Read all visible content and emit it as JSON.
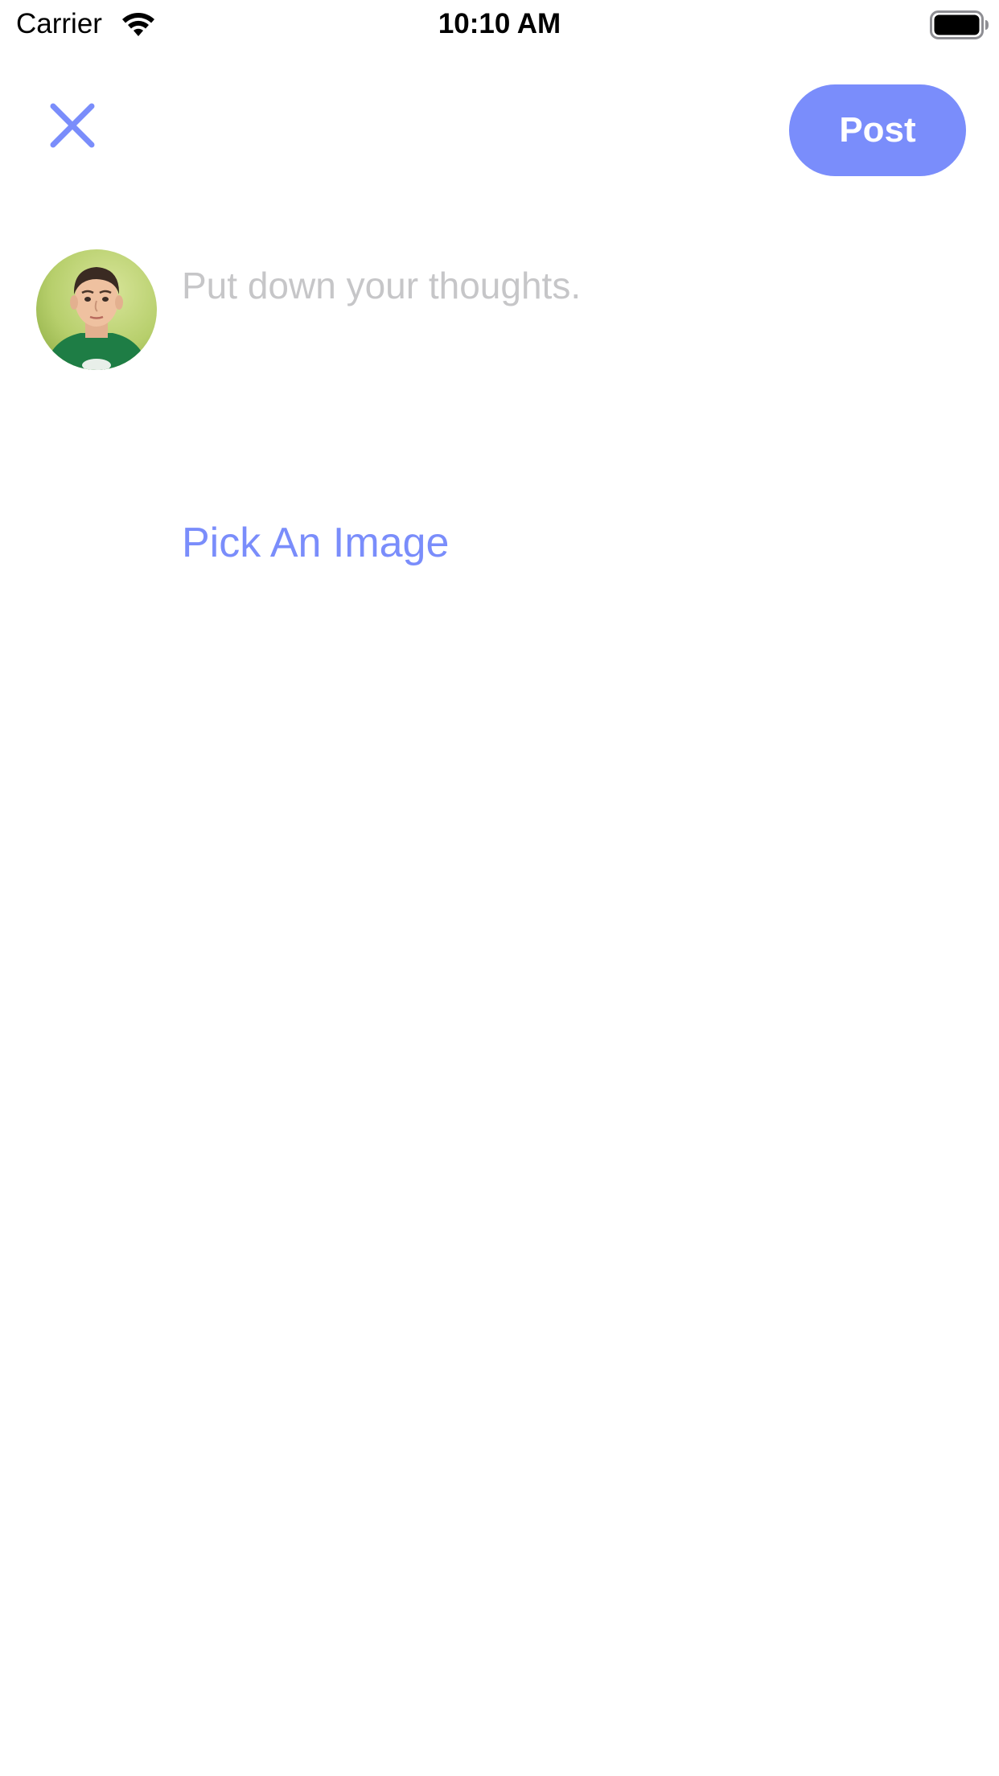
{
  "status_bar": {
    "carrier": "Carrier",
    "time": "10:10 AM"
  },
  "nav": {
    "close_icon": "close-icon",
    "post_label": "Post"
  },
  "composer": {
    "avatar_icon": "user-avatar",
    "placeholder": "Put down your thoughts.",
    "value": "",
    "pick_image_label": "Pick An Image"
  },
  "colors": {
    "accent": "#7a8dfb",
    "placeholder": "#c6c6c8",
    "background": "#ffffff"
  }
}
